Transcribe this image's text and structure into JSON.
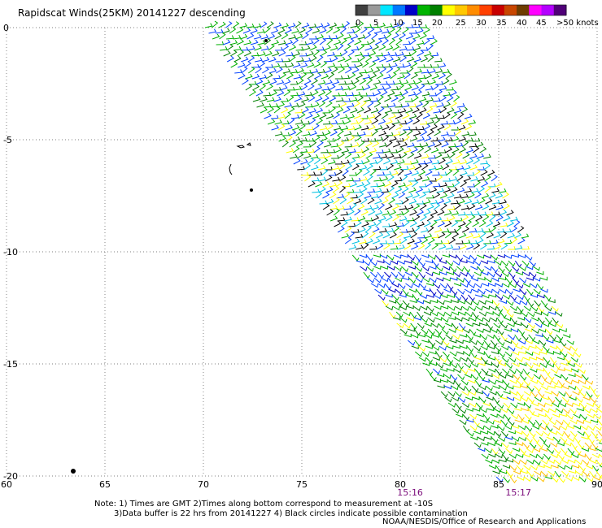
{
  "title": "Rapidscat Winds(25KM) 20141227 descending",
  "legend": {
    "labels": [
      "0",
      "5",
      "10",
      "15",
      "20",
      "25",
      "30",
      "35",
      "40",
      "45",
      ">50 knots"
    ],
    "colors": [
      "#404040",
      "#9a9a9a",
      "#00e6ff",
      "#0078ff",
      "#0000c8",
      "#00b400",
      "#008000",
      "#ffff00",
      "#ffc800",
      "#ff8c00",
      "#ff4000",
      "#c80000",
      "#c84600",
      "#6e3c00",
      "#ff00ff",
      "#b400ff",
      "#500078"
    ]
  },
  "map": {
    "lon_ticks": [
      "60",
      "65",
      "70",
      "75",
      "80",
      "85",
      "90"
    ],
    "lat_ticks": [
      "0",
      "-5",
      "-10",
      "-15",
      "-20"
    ],
    "pass_times": [
      {
        "lon": 80.5,
        "label": "15:16"
      },
      {
        "lon": 86.0,
        "label": "15:17"
      }
    ],
    "wind_colors": [
      "#000000",
      "#00c0e0",
      "#0040ff",
      "#0000c0",
      "#00b000",
      "#008000",
      "#ffff00",
      "#ffc000"
    ]
  },
  "notes": {
    "line1": "Note: 1) Times are GMT 2)Times along bottom correspond to measurement at -10S",
    "line2": "3)Data buffer is 22 hrs from 20141227 4) Black circles indicate possible contamination"
  },
  "credit": "NOAA/NESDIS/Office of Research and Applications"
}
